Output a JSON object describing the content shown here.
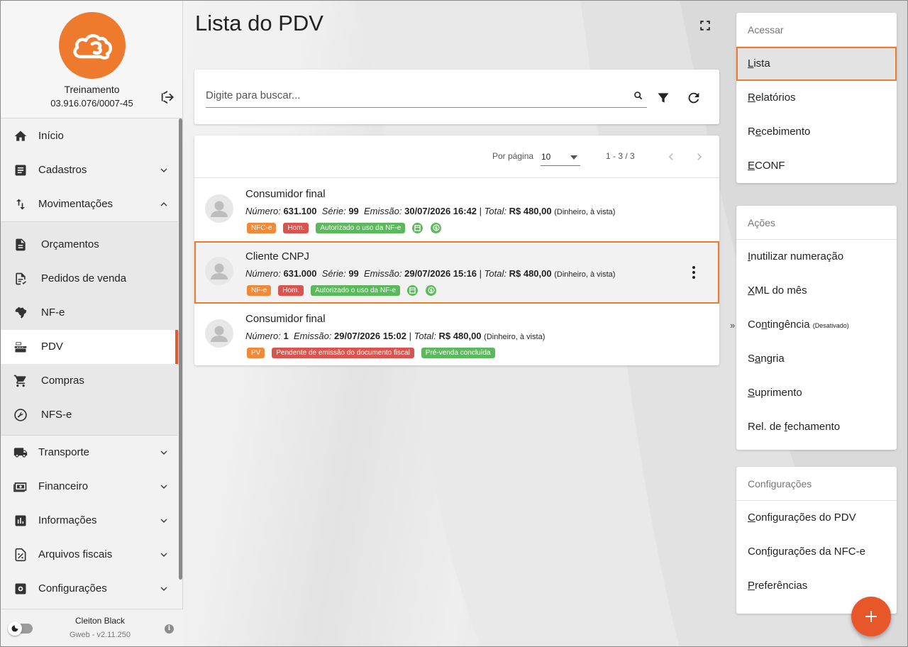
{
  "sidebar": {
    "company_name": "Treinamento",
    "company_cnpj": "03.916.076/0007-45",
    "items": [
      {
        "label": "Início",
        "icon": "home-icon"
      },
      {
        "label": "Cadastros",
        "icon": "list-box-icon"
      },
      {
        "label": "Movimentações",
        "icon": "swap-icon"
      }
    ],
    "submenu": [
      {
        "label": "Orçamentos",
        "icon": "document-icon"
      },
      {
        "label": "Pedidos de venda",
        "icon": "document-check-icon"
      },
      {
        "label": "NF-e",
        "icon": "brazil-map-icon"
      },
      {
        "label": "PDV",
        "icon": "cash-register-icon",
        "active": true
      },
      {
        "label": "Compras",
        "icon": "cart-icon"
      },
      {
        "label": "NFS-e",
        "icon": "wrench-icon"
      }
    ],
    "items_after": [
      {
        "label": "Transporte",
        "icon": "truck-icon"
      },
      {
        "label": "Financeiro",
        "icon": "money-icon"
      },
      {
        "label": "Informações",
        "icon": "bar-chart-icon"
      },
      {
        "label": "Arquivos fiscais",
        "icon": "percent-file-icon"
      },
      {
        "label": "Configurações",
        "icon": "settings-icon"
      }
    ],
    "footer": {
      "user_name": "Cleiton Black",
      "version": "Gweb - v2.11.250"
    }
  },
  "main": {
    "title": "Lista do PDV",
    "search": {
      "placeholder": "Digite para buscar..."
    },
    "pager": {
      "per_page_label": "Por página",
      "per_page_value": "10",
      "range": "1 - 3 / 3"
    },
    "rows": [
      {
        "title": "Consumidor final",
        "numero_label": "Número:",
        "numero": "631.100",
        "serie_label": "Série:",
        "serie": "99",
        "emissao_label": "Emissão:",
        "emissao": "30/07/2026 16:42",
        "total_label": "Total:",
        "total": "R$ 480,00",
        "payment": "(Dinheiro, à vista)",
        "chips": [
          "NFC-e",
          "Hom.",
          "Autorizado o uso da NF-e"
        ]
      },
      {
        "title": "Cliente CNPJ",
        "numero_label": "Número:",
        "numero": "631.000",
        "serie_label": "Série:",
        "serie": "99",
        "emissao_label": "Emissão:",
        "emissao": "29/07/2026 15:16",
        "total_label": "Total:",
        "total": "R$ 480,00",
        "payment": "(Dinheiro, à vista)",
        "chips": [
          "NF-e",
          "Hom.",
          "Autorizado o uso da NF-e"
        ]
      },
      {
        "title": "Consumidor final",
        "numero_label": "Número:",
        "numero": "1",
        "emissao_label": "Emissão:",
        "emissao": "29/07/2026 15:02",
        "total_label": "Total:",
        "total": "R$ 480,00",
        "payment": "(Dinheiro, à vista)",
        "chips": [
          "PV",
          "Pendente de emissão do documento fiscal",
          "Pré-venda concluída"
        ]
      }
    ]
  },
  "right": {
    "acessar": {
      "title": "Acessar",
      "items": [
        {
          "pre": "",
          "u": "L",
          "post": "ista"
        },
        {
          "pre": "",
          "u": "R",
          "post": "elatórios"
        },
        {
          "pre": "R",
          "u": "e",
          "post": "cebimento"
        },
        {
          "pre": "",
          "u": "E",
          "post": "CONF"
        }
      ]
    },
    "acoes": {
      "title": "Ações",
      "items": [
        {
          "pre": "",
          "u": "I",
          "post": "nutilizar numeração"
        },
        {
          "pre": "",
          "u": "X",
          "post": "ML do mês"
        },
        {
          "pre": "Co",
          "u": "n",
          "post": "tingência",
          "note": "(Desativado)"
        },
        {
          "pre": "S",
          "u": "a",
          "post": "ngria"
        },
        {
          "pre": "",
          "u": "S",
          "post": "uprimento"
        },
        {
          "pre": "Rel. de ",
          "u": "f",
          "post": "echamento"
        }
      ]
    },
    "configuracoes": {
      "title": "Configurações",
      "items": [
        {
          "pre": "",
          "u": "C",
          "post": "onfigurações do PDV"
        },
        {
          "pre": "Con",
          "u": "f",
          "post": "igurações da NFC-e"
        },
        {
          "pre": "",
          "u": "P",
          "post": "referências"
        }
      ]
    }
  },
  "colors": {
    "accent": "#e8572a",
    "orange": "#ee7a2d",
    "chip_orange": "#f08a3a",
    "chip_red": "#d9534f",
    "chip_green": "#5cb85c"
  }
}
